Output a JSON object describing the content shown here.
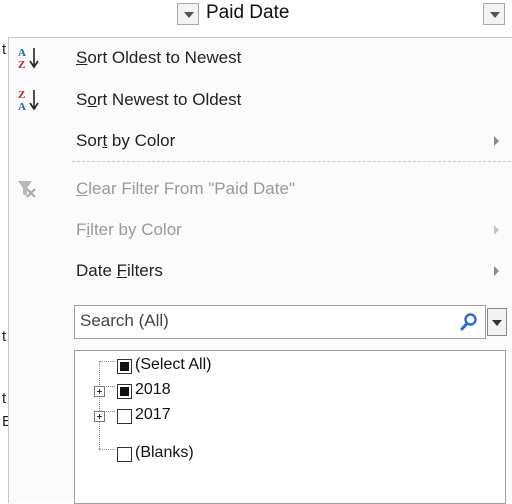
{
  "header": {
    "column_title": "Paid Date"
  },
  "sheet_fragments": [
    "t",
    "t",
    "t",
    "E"
  ],
  "menu": {
    "sort_oldest": {
      "pre": "",
      "ul": "S",
      "post": "ort Oldest to Newest"
    },
    "sort_newest": {
      "pre": "S",
      "ul": "o",
      "post": "rt Newest to Oldest"
    },
    "sort_color": {
      "pre": "Sor",
      "ul": "t",
      "post": " by Color"
    },
    "clear_filter": {
      "pre": "",
      "ul": "C",
      "post": "lear Filter From \"Paid Date\""
    },
    "filter_color": {
      "pre": "F",
      "ul": "i",
      "post": "lter by Color"
    },
    "date_filters": {
      "pre": "Date ",
      "ul": "F",
      "post": "ilters"
    }
  },
  "search": {
    "placeholder": "Search (All)"
  },
  "tree": {
    "select_all": "(Select All)",
    "year_2018": "2018",
    "year_2017": "2017",
    "blanks": "(Blanks)"
  },
  "icons": {
    "sort_asc": "sort-a-z-icon",
    "sort_desc": "sort-z-a-icon",
    "clear_filter": "funnel-clear-icon",
    "search": "magnifier-icon"
  },
  "colors": {
    "search_icon": "#2b6cd4",
    "disabled_text": "#9a9a9a"
  }
}
